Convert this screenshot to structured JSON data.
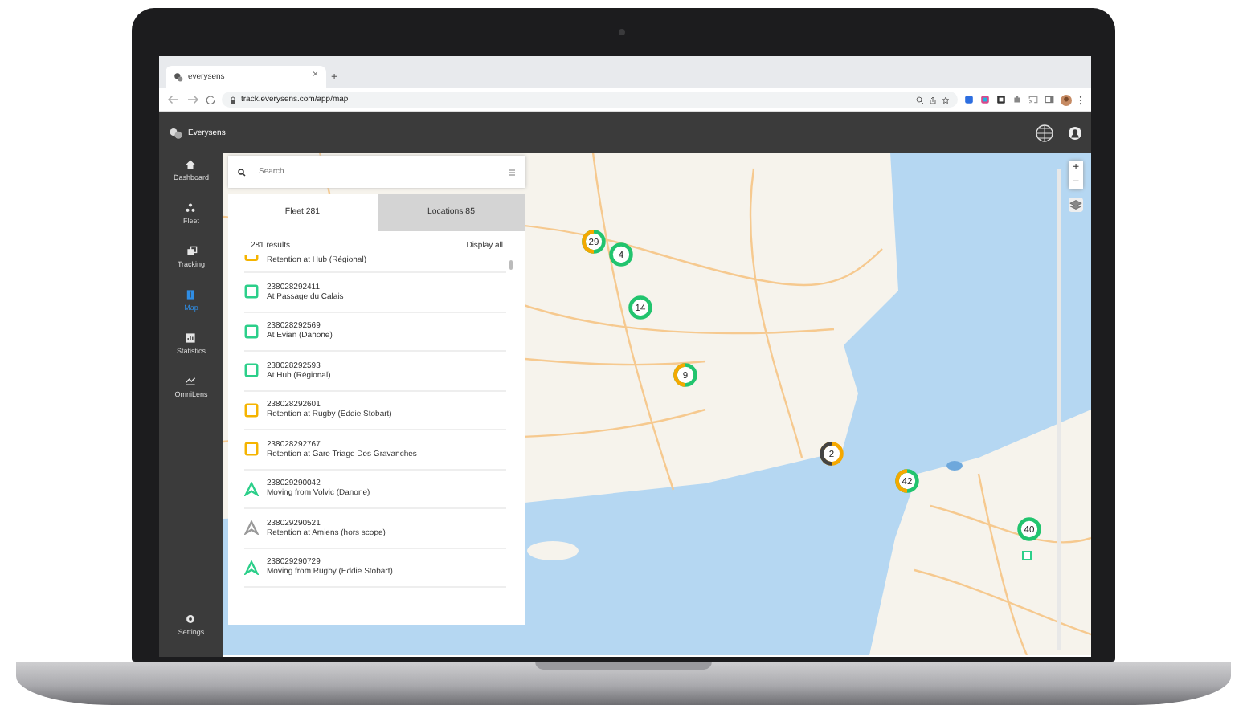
{
  "browser": {
    "tab_title": "everysens",
    "tab_close": "×",
    "new_tab": "+",
    "url": "track.everysens.com/app/map"
  },
  "app": {
    "brand": "Everysens"
  },
  "sidebar": {
    "items": [
      {
        "label": "Dashboard",
        "selected": false
      },
      {
        "label": "Fleet",
        "selected": false
      },
      {
        "label": "Tracking",
        "selected": false
      },
      {
        "label": "Map",
        "selected": true
      },
      {
        "label": "Statistics",
        "selected": false
      },
      {
        "label": "OmniLens",
        "selected": false
      },
      {
        "label": "Settings",
        "selected": false
      }
    ]
  },
  "panel": {
    "search": {
      "placeholder": "Search"
    },
    "tabs": [
      {
        "label": "Fleet 281",
        "selected": true
      },
      {
        "label": "Locations 85",
        "selected": false
      }
    ],
    "results": "281 results",
    "display_all": "Display all",
    "items": [
      {
        "kind": "square",
        "color": "#f5b400",
        "status": "Retention at Hub (Régional)",
        "partial": true
      },
      {
        "kind": "square",
        "color": "#2ccf8a",
        "id": "238028292411",
        "status": "At Passage du Calais",
        "partial": false
      },
      {
        "kind": "square",
        "color": "#2ccf8a",
        "id": "238028292569",
        "status": "At Evian (Danone)",
        "partial": false
      },
      {
        "kind": "square",
        "color": "#2ccf8a",
        "id": "238028292593",
        "status": "At Hub (Régional)",
        "partial": false
      },
      {
        "kind": "square",
        "color": "#f5b400",
        "id": "238028292601",
        "status": "Retention at Rugby (Eddie Stobart)",
        "partial": false
      },
      {
        "kind": "square",
        "color": "#f5b400",
        "id": "238028292767",
        "status": "Retention at Gare Triage Des Gravanches",
        "partial": false
      },
      {
        "kind": "triangle",
        "color": "#2ccf8a",
        "id": "238029290042",
        "status": "Moving from Volvic (Danone)",
        "partial": false
      },
      {
        "kind": "triangle",
        "color": "#9a9a9a",
        "id": "238029290521",
        "status": "Retention at Amiens (hors scope)",
        "partial": false
      },
      {
        "kind": "triangle",
        "color": "#2ccf8a",
        "id": "238029290729",
        "status": "Moving from Rugby (Eddie Stobart)",
        "partial": false
      }
    ]
  },
  "map": {
    "zoom_in": "+",
    "zoom_out": "−",
    "clusters": [
      {
        "label": "29",
        "segments": [
          {
            "color": "#22c46e"
          },
          {
            "color": "#f5a800"
          }
        ]
      },
      {
        "label": "4",
        "segments": [
          {
            "color": "#22c46e"
          }
        ]
      },
      {
        "label": "14",
        "segments": [
          {
            "color": "#22c46e"
          }
        ]
      },
      {
        "label": "9",
        "segments": [
          {
            "color": "#22c46e"
          },
          {
            "color": "#f5a800"
          }
        ]
      },
      {
        "label": "2",
        "segments": [
          {
            "color": "#f5a800"
          },
          {
            "color": "#444444"
          }
        ]
      },
      {
        "label": "42",
        "segments": [
          {
            "color": "#22c46e"
          },
          {
            "color": "#f5a800"
          }
        ]
      },
      {
        "label": "40",
        "segments": [
          {
            "color": "#22c46e"
          }
        ]
      }
    ]
  }
}
